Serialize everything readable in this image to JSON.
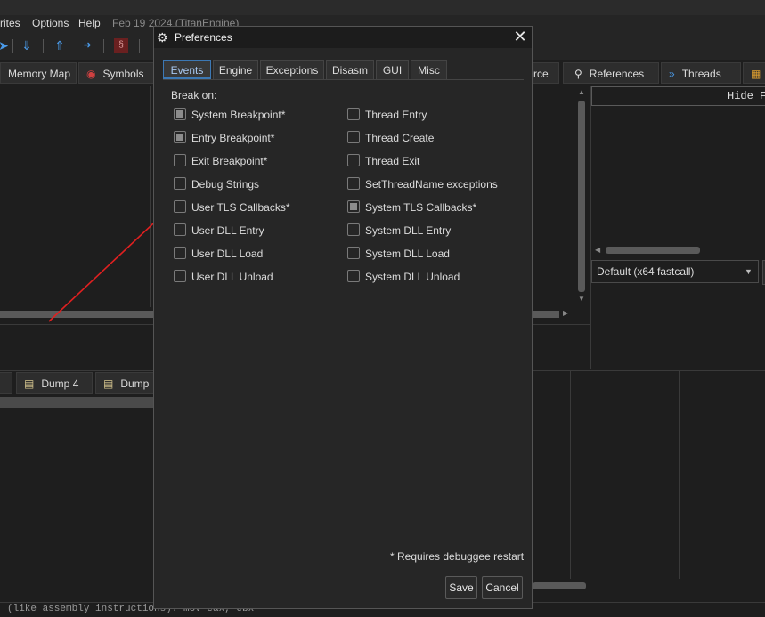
{
  "menu": {
    "items": [
      "rites",
      "Options",
      "Help"
    ],
    "date_text": "Feb 19 2024 (TitanEngine)"
  },
  "toolbar": {
    "icons": [
      "run-arrow-icon",
      "step-down-icon",
      "step-up-icon",
      "run-to-user-icon",
      "script-icon"
    ]
  },
  "main_tabs": {
    "memory_map": "Memory Map",
    "symbols": "Symbols",
    "source": "rce",
    "references": "References",
    "threads": "Threads"
  },
  "registers": {
    "hide_fpu": "Hide F",
    "calling_convention": "Default (x64 fastcall)"
  },
  "dump_tabs": {
    "dump4": "Dump 4",
    "dump5": "Dump"
  },
  "status": {
    "text": "(like assembly instructions): mov eax, ebx"
  },
  "dialog": {
    "title": "Preferences",
    "tabs": [
      "Events",
      "Engine",
      "Exceptions",
      "Disasm",
      "GUI",
      "Misc"
    ],
    "active_tab": "Events",
    "break_on_label": "Break on:",
    "left_column": [
      {
        "label": "System Breakpoint*",
        "state": "partial"
      },
      {
        "label": "Entry Breakpoint*",
        "state": "partial"
      },
      {
        "label": "Exit Breakpoint*",
        "state": "unchecked"
      },
      {
        "label": "Debug Strings",
        "state": "unchecked"
      },
      {
        "label": "User TLS Callbacks*",
        "state": "unchecked"
      },
      {
        "label": "User DLL Entry",
        "state": "unchecked"
      },
      {
        "label": "User DLL Load",
        "state": "unchecked"
      },
      {
        "label": "User DLL Unload",
        "state": "unchecked"
      }
    ],
    "right_column": [
      {
        "label": "Thread Entry",
        "state": "unchecked"
      },
      {
        "label": "Thread Create",
        "state": "unchecked"
      },
      {
        "label": "Thread Exit",
        "state": "unchecked"
      },
      {
        "label": "SetThreadName exceptions",
        "state": "unchecked"
      },
      {
        "label": "System TLS Callbacks*",
        "state": "partial"
      },
      {
        "label": "System DLL Entry",
        "state": "unchecked"
      },
      {
        "label": "System DLL Load",
        "state": "unchecked"
      },
      {
        "label": "System DLL Unload",
        "state": "unchecked"
      }
    ],
    "footnote": "* Requires debuggee restart",
    "save_label": "Save",
    "cancel_label": "Cancel"
  },
  "colors": {
    "annotation_arrow": "#e02020",
    "active_tab_accent": "#3c78b4"
  }
}
